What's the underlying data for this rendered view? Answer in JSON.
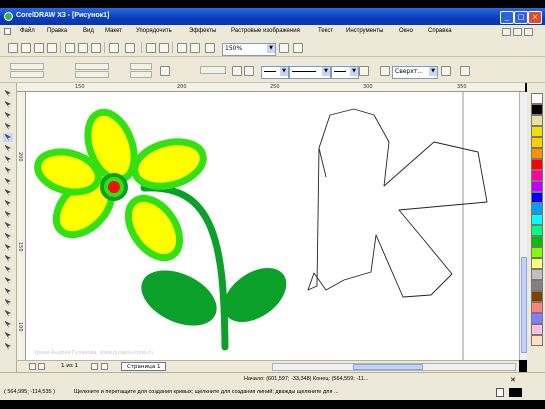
{
  "window": {
    "title": "CorelDRAW X3 - [Рисунок1]",
    "controls": {
      "minimize": "_",
      "maximize": "□",
      "close": "×"
    }
  },
  "menu": [
    "Файл",
    "Правка",
    "Вид",
    "Макет",
    "Упорядочить",
    "Эффекты",
    "Растровые изображения",
    "Текст",
    "Инструменты",
    "Окно",
    "Справка"
  ],
  "toolbar": {
    "zoom_value": "150%",
    "font_value": "Сверхт..."
  },
  "ruler_top_labels": [
    "150",
    "200",
    "250",
    "300",
    "350"
  ],
  "ruler_left_labels": [
    "200",
    "150",
    "100"
  ],
  "colors": {
    "petal_fill": "#ffff00",
    "petal_outline": "#33e010",
    "flower_center": "#ee1111",
    "leaf_stem": "#0aa02a",
    "title_bar": "#0a3dbc"
  },
  "palette": [
    "#ffffff",
    "#000000",
    "#e8e0a0",
    "#f0e000",
    "#ffd000",
    "#ff9000",
    "#ff0000",
    "#ff00a0",
    "#c000ff",
    "#0000ff",
    "#00a0ff",
    "#00ffff",
    "#00ff80",
    "#00c000",
    "#80ff00",
    "#ffff80",
    "#c0c0c0",
    "#808080",
    "#804000",
    "#ff8080",
    "#8080ff",
    "#ffc0e0",
    "#ffe0c0"
  ],
  "pagebar": {
    "page_count": "1 из 1",
    "page_tab": "Страница 1"
  },
  "watermark": "Уроки Андрея Гулякова, www.gulakov-corel.ru",
  "status": {
    "coordinates": "( 564,995; -114,535 )",
    "hint": "Щелкните и перетащите для создания кривых; щелкните для создания линий; дважды щелкните для ...",
    "position": "Начало: (601,597; -33,348) Конец: (564,559; -11..."
  }
}
